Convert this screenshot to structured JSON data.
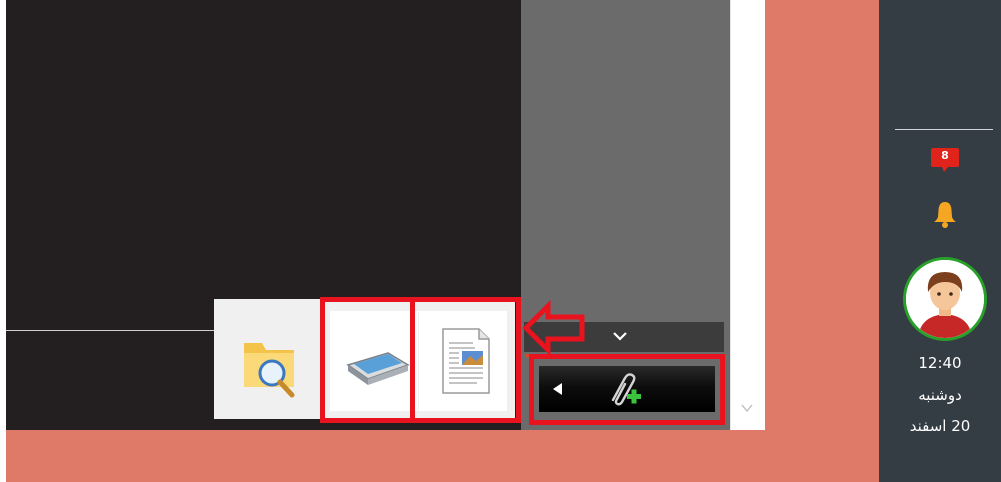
{
  "sidebar": {
    "notification_count": "8",
    "clock": {
      "time": "12:40",
      "weekday": "دوشنبه",
      "date": "20 اسفند"
    },
    "icons": [
      "message-badge-icon",
      "bell-icon",
      "user-avatar"
    ]
  },
  "attachment_toolbar": {
    "icons": [
      "expand-left-icon",
      "attach-add-icon"
    ]
  },
  "file_source_panel": {
    "icons": [
      "folder-search-icon",
      "scanner-icon",
      "document-image-icon"
    ]
  },
  "colors": {
    "highlight_red": "#e8131e",
    "background_salmon": "#e07a68",
    "sidebar_dark": "#343c44",
    "accent_green": "#28a02a",
    "accent_orange": "#f5a623"
  }
}
